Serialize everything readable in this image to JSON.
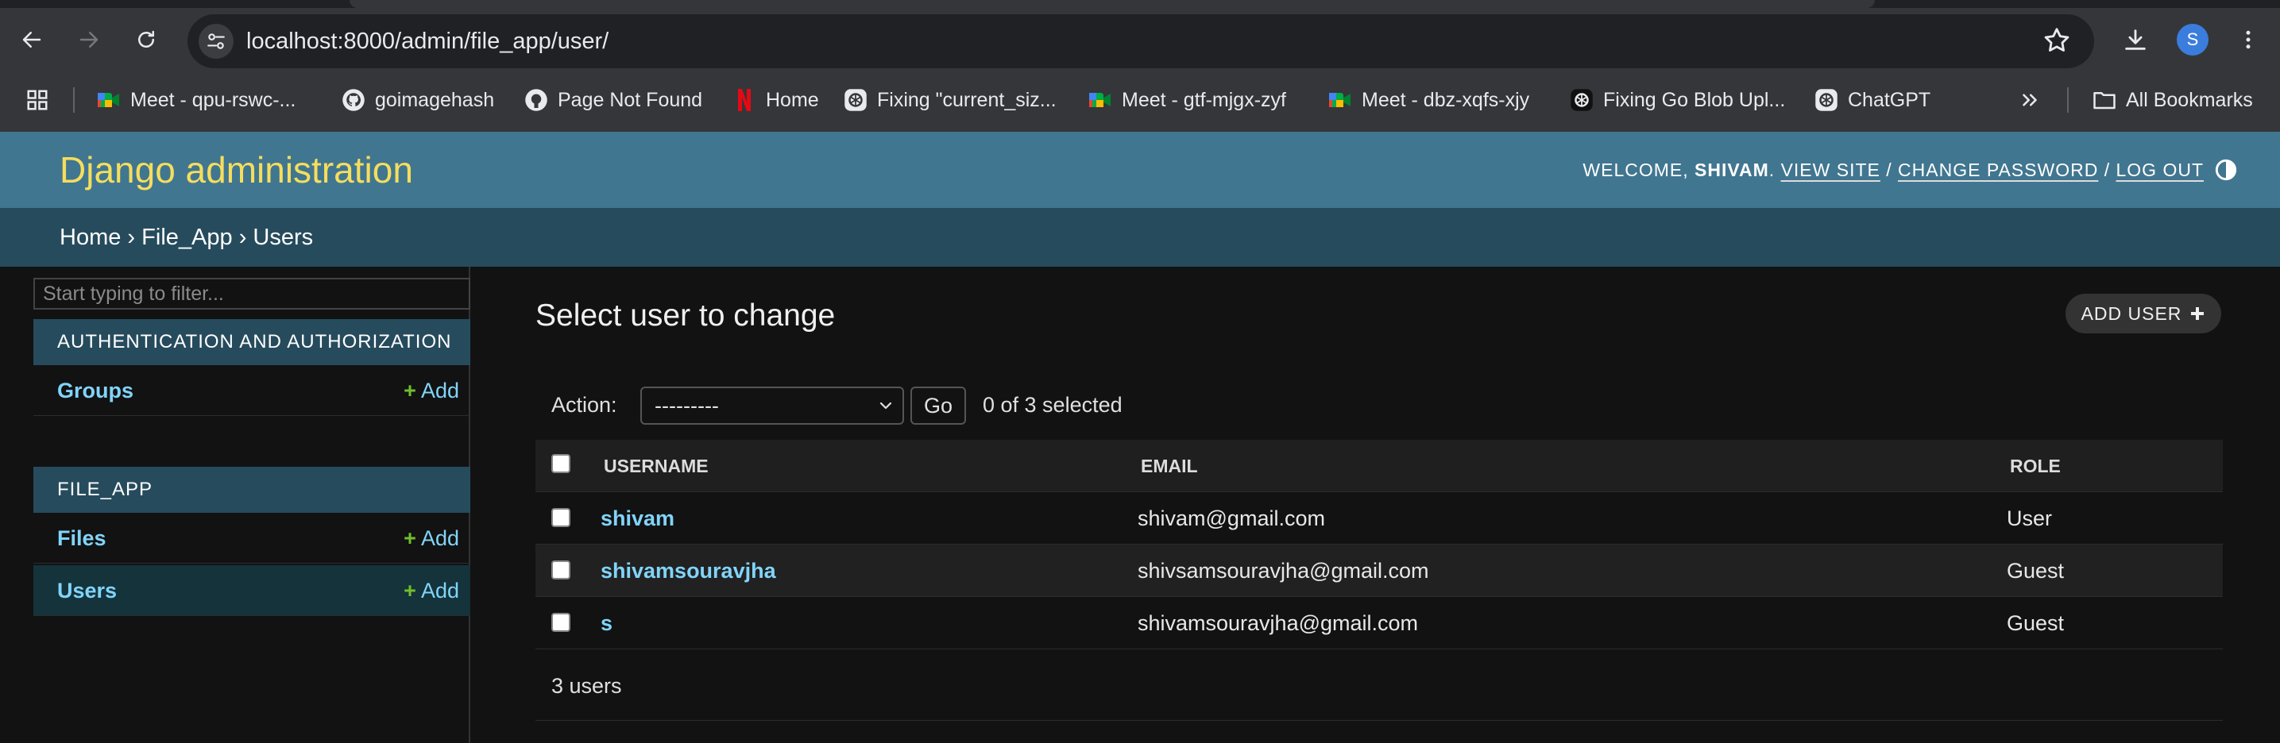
{
  "browser": {
    "url": "localhost:8000/admin/file_app/user/",
    "profile_initial": "S",
    "bookmarks": [
      {
        "label": "Meet - qpu-rswc-...",
        "icon": "google-meet-icon"
      },
      {
        "label": "goimagehash",
        "icon": "github-icon"
      },
      {
        "label": "Page Not Found",
        "icon": "github-icon"
      },
      {
        "label": "Home",
        "icon": "netflix-icon"
      },
      {
        "label": "Fixing \"current_siz...",
        "icon": "openai-icon"
      },
      {
        "label": "Meet - gtf-mjgx-zyf",
        "icon": "google-meet-icon"
      },
      {
        "label": "Meet - dbz-xqfs-xjy",
        "icon": "google-meet-icon"
      },
      {
        "label": "Fixing Go Blob Upl...",
        "icon": "openai-icon"
      },
      {
        "label": "ChatGPT",
        "icon": "openai-icon"
      }
    ],
    "all_bookmarks": "All Bookmarks"
  },
  "header": {
    "branding": "Django administration",
    "welcome": "WELCOME,",
    "username": "SHIVAM",
    "view_site": "VIEW SITE",
    "change_password": "CHANGE PASSWORD",
    "log_out": "LOG OUT",
    "sep": "/",
    "dot": "."
  },
  "breadcrumbs": {
    "items": [
      "Home",
      "File_App",
      "Users"
    ],
    "sep": "›"
  },
  "sidebar": {
    "filter_placeholder": "Start typing to filter...",
    "modules": [
      {
        "caption": "AUTHENTICATION AND AUTHORIZATION",
        "models": [
          {
            "name": "Groups",
            "add": "Add"
          }
        ]
      },
      {
        "caption": "FILE_APP",
        "models": [
          {
            "name": "Files",
            "add": "Add"
          },
          {
            "name": "Users",
            "add": "Add",
            "active": true
          }
        ]
      }
    ]
  },
  "content": {
    "title": "Select user to change",
    "add_button": "ADD USER",
    "action_label": "Action:",
    "action_selected": "---------",
    "go_label": "Go",
    "counter": "0 of 3 selected",
    "columns": [
      "USERNAME",
      "EMAIL",
      "ROLE"
    ],
    "rows": [
      {
        "username": "shivam",
        "email": "shivam@gmail.com",
        "role": "User"
      },
      {
        "username": "shivamsouravjha",
        "email": "shivsamsouravjha@gmail.com",
        "role": "Guest"
      },
      {
        "username": "s",
        "email": "shivamsouravjha@gmail.com",
        "role": "Guest"
      }
    ],
    "paginator": "3 users"
  },
  "colors": {
    "header_bg": "#417690",
    "breadcrumb_bg": "#264b5d",
    "branding": "#f5dd5d",
    "link": "#81d4fa",
    "add_plus": "#70bf2b",
    "page_bg": "#121212"
  }
}
